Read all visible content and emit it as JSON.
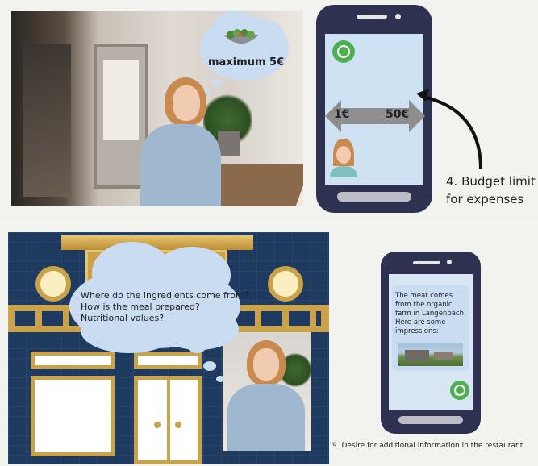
{
  "top": {
    "bubble_text": "maximum 5€",
    "arrow_left": "1€",
    "arrow_right": "50€",
    "caption_line1": "4. Budget limit",
    "caption_line2": "for expenses",
    "icons": [
      "whatsapp-icon",
      "salad-bowl-icon",
      "woman-avatar-icon"
    ]
  },
  "bottom": {
    "thought_line1": "Where do the ingredients come from?",
    "thought_line2": "How is the meal prepared?",
    "thought_line3": "Nutritional values?",
    "phone_message": "The meat comes from the organic farm in Langenbach. Here are some impressions:",
    "caption": "9. Desire for additional information in the restaurant"
  },
  "colors": {
    "bubble": "#c9dcf2",
    "phone": "#2f3150",
    "screen": "#cfe2f3",
    "whatsapp": "#4caf50",
    "restaurant_blue": "#1f3a5f",
    "gold": "#c9a24a"
  }
}
